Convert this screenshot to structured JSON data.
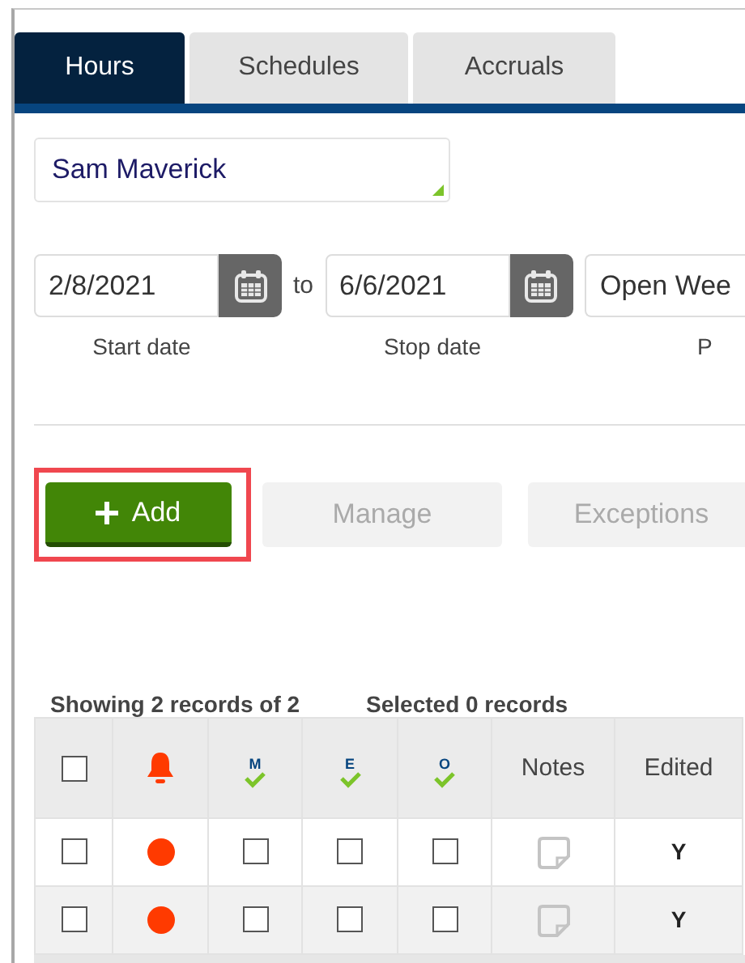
{
  "tabs": [
    {
      "label": "Hours",
      "selected": true
    },
    {
      "label": "Schedules",
      "selected": false
    },
    {
      "label": "Accruals",
      "selected": false
    }
  ],
  "employee": {
    "value": "Sam Maverick"
  },
  "date_range": {
    "start": {
      "value": "2/8/2021",
      "label": "Start date"
    },
    "separator": "to",
    "stop": {
      "value": "6/6/2021",
      "label": "Stop date"
    },
    "period": {
      "value": "Open Wee",
      "label": "P"
    }
  },
  "actions": [
    {
      "label": "Add",
      "kind": "primary",
      "highlighted": true,
      "disabled": false
    },
    {
      "label": "Manage",
      "kind": "secondary",
      "highlighted": false,
      "disabled": true
    },
    {
      "label": "Exceptions",
      "kind": "secondary",
      "highlighted": false,
      "disabled": true
    }
  ],
  "summary": {
    "showing": "Showing 2 records of 2",
    "selected": "Selected 0 records"
  },
  "table": {
    "columns": [
      {
        "kind": "checkbox",
        "checked": false
      },
      {
        "kind": "alert"
      },
      {
        "kind": "approval",
        "letter": "M"
      },
      {
        "kind": "approval",
        "letter": "E"
      },
      {
        "kind": "approval",
        "letter": "O"
      },
      {
        "kind": "text",
        "label": "Notes"
      },
      {
        "kind": "text",
        "label": "Edited"
      }
    ],
    "rows": [
      {
        "selected": false,
        "alert": true,
        "approvals": [
          false,
          false,
          false
        ],
        "edited": "Y"
      },
      {
        "selected": false,
        "alert": true,
        "approvals": [
          false,
          false,
          false
        ],
        "edited": "Y"
      }
    ]
  }
}
